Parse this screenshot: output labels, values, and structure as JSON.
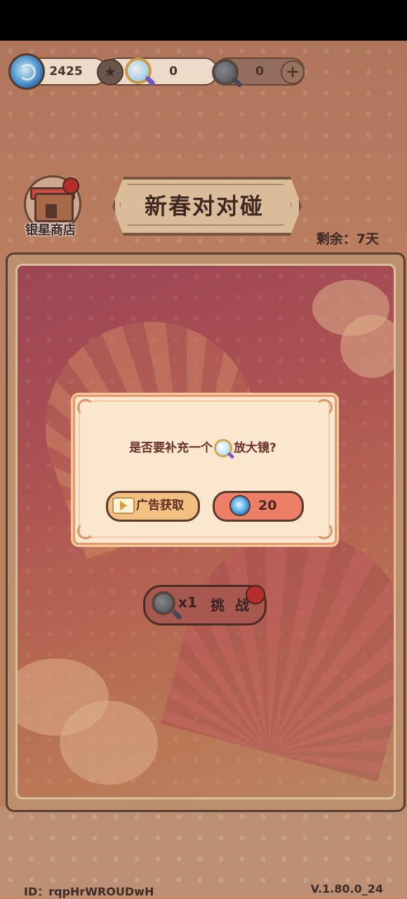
{
  "resources": {
    "coins": "2425",
    "magnifier_count": "0",
    "dark_magnifier_count": "0"
  },
  "shop": {
    "label": "银星商店"
  },
  "event": {
    "title": "新春对对碰",
    "remaining": "剩余：7天"
  },
  "challenge": {
    "count": "x1",
    "label": "挑 战"
  },
  "dialog": {
    "question_prefix": "是否要补充一个",
    "question_suffix": "放大镜?",
    "ad_button": "广告获取",
    "buy_price": "20"
  },
  "footer": {
    "id": "ID：rqpHrWROUDwH",
    "version": "V.1.80.0_24"
  },
  "colors": {
    "accent_red": "#c0302e",
    "dialog_bg": "#fbe7cd",
    "buy_button": "#ec7f66",
    "ad_button": "#f2c081"
  }
}
